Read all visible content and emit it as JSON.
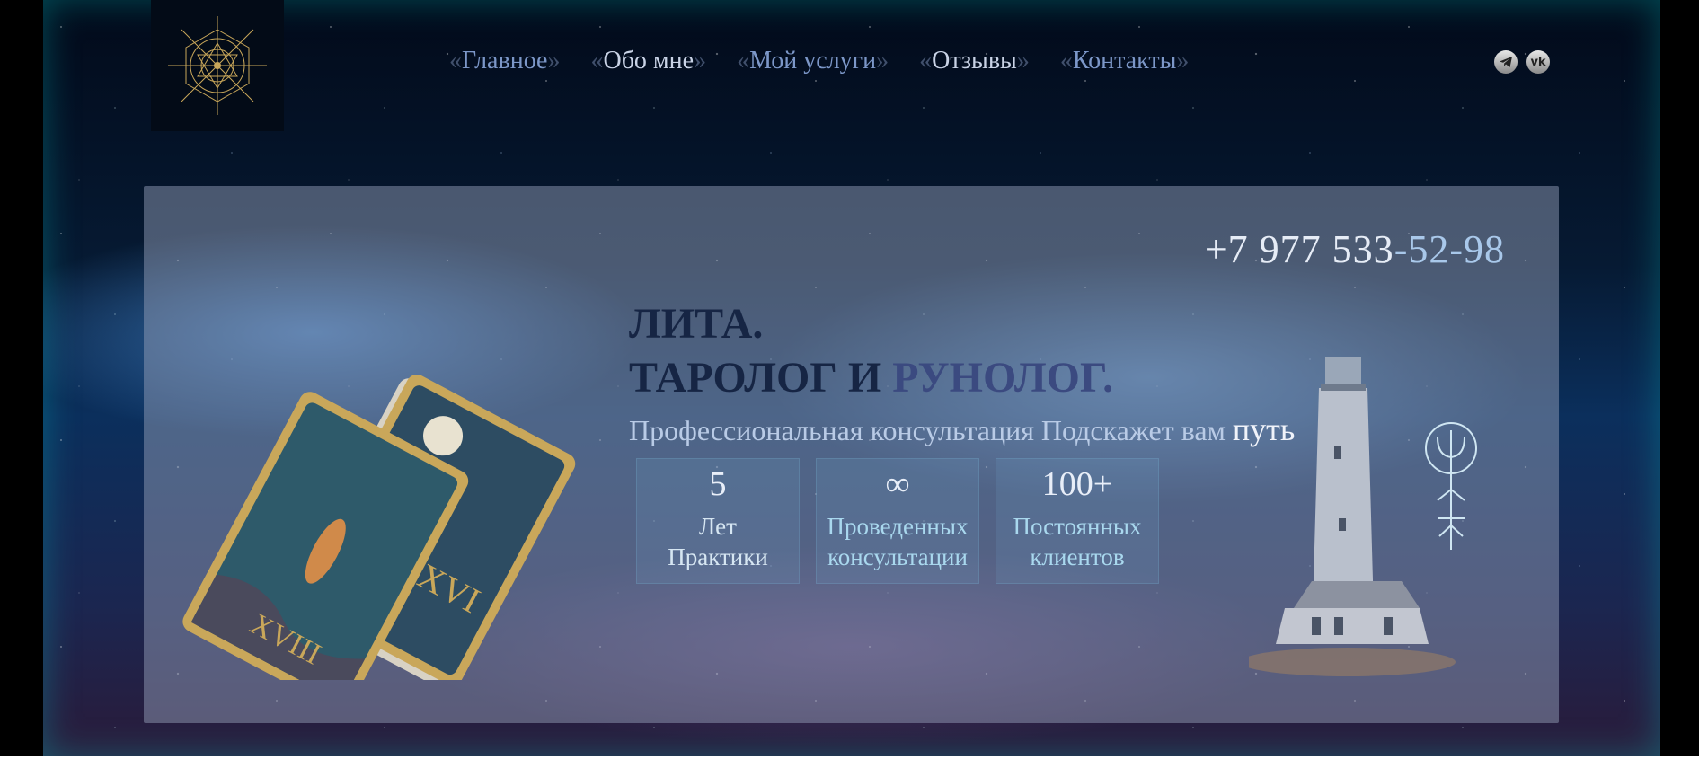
{
  "nav": {
    "items": [
      {
        "open": "«",
        "label": "Главное",
        "close": "»"
      },
      {
        "open": "«",
        "label": "Обо мне",
        "close": "»"
      },
      {
        "open": "«",
        "label": "Мой услуги",
        "close": "»"
      },
      {
        "open": "«",
        "label": "Отзывы",
        "close": "»"
      },
      {
        "open": "«",
        "label": "Контакты",
        "close": "»"
      }
    ]
  },
  "socials": {
    "telegram_icon": "telegram-icon",
    "vk_label": "vk"
  },
  "hero": {
    "phone_main": "+7 977 533",
    "phone_tail": "-52-98",
    "title_line1": "ЛИТА.",
    "title_line2_a": "ТАРОЛОГ И ",
    "title_line2_b": "РУНОЛОГ.",
    "subtitle_main": "Профессиональная консультация Подскажет вам ",
    "subtitle_big": "путь",
    "stats": [
      {
        "value": "5",
        "line1": "Лет",
        "line2": "Практики"
      },
      {
        "value": "∞",
        "line1": "Проведенных",
        "line2": "консультации"
      },
      {
        "value": "100+",
        "line1": "Постоянных",
        "line2": "клиентов"
      }
    ]
  },
  "colors": {
    "nav_odd": "#7c97c8",
    "nav_even": "#c9d3e6",
    "title": "#162544",
    "panel": "rgba(150,160,185,0.48)"
  }
}
